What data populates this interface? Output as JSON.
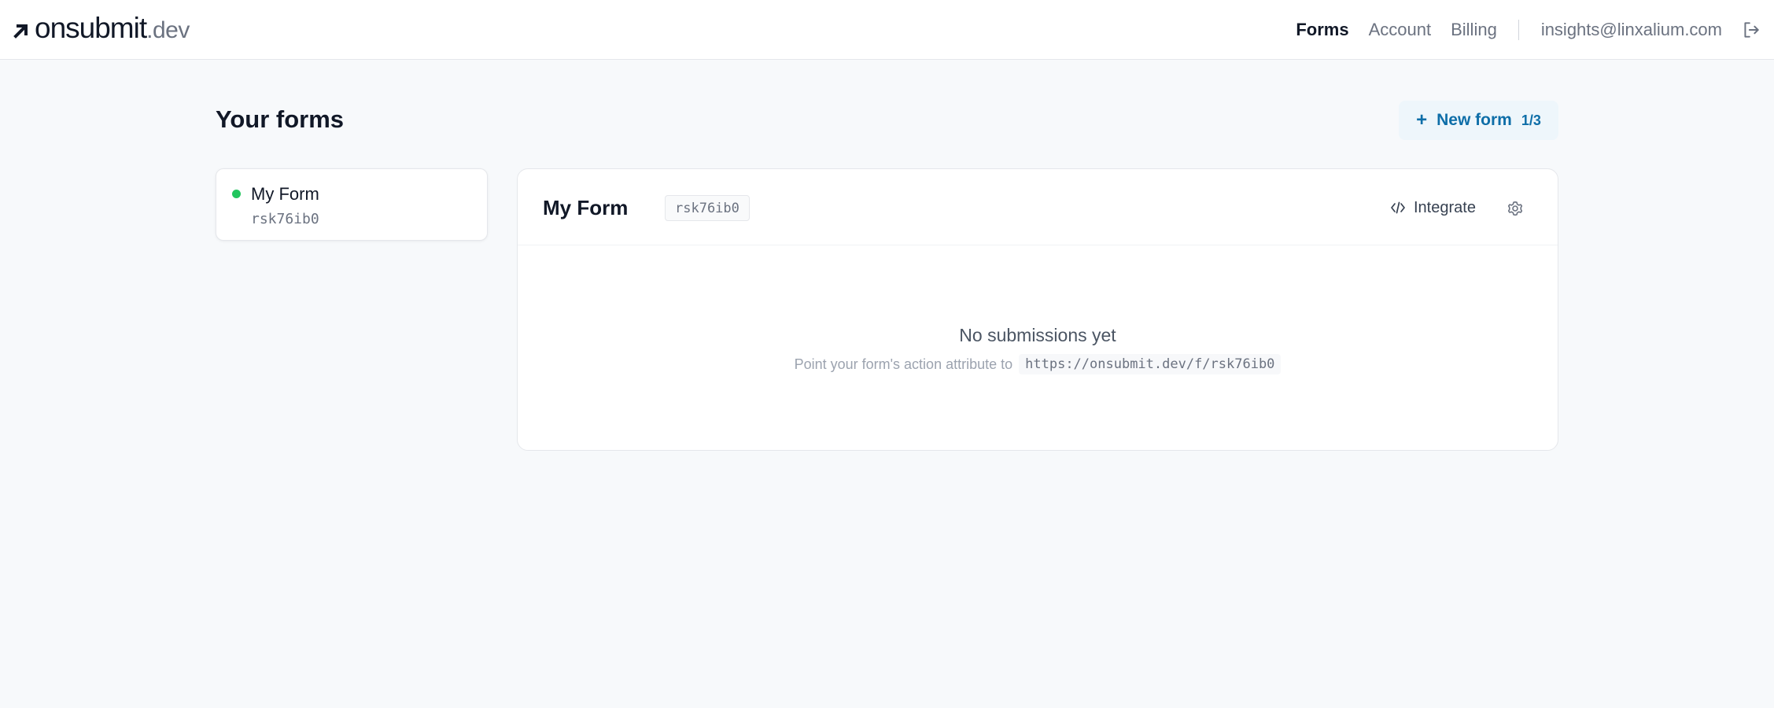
{
  "header": {
    "logo": {
      "main": "onsubmit",
      "tld": ".dev"
    },
    "nav": [
      {
        "label": "Forms",
        "active": true
      },
      {
        "label": "Account",
        "active": false
      },
      {
        "label": "Billing",
        "active": false
      }
    ],
    "user_email": "insights@linxalium.com",
    "logout_icon": "logout-icon"
  },
  "page": {
    "title": "Your forms",
    "new_form_button": {
      "plus": "+",
      "label": "New form",
      "quota": "1/3"
    }
  },
  "forms": [
    {
      "name": "My Form",
      "id": "rsk76ib0",
      "status": "active",
      "status_color": "#22c55e"
    }
  ],
  "detail": {
    "title": "My Form",
    "id": "rsk76ib0",
    "integrate_label": "Integrate",
    "integrate_icon": "code-icon",
    "settings_icon": "gear-icon",
    "empty": {
      "title": "No submissions yet",
      "hint": "Point your form's action attribute to",
      "url": "https://onsubmit.dev/f/rsk76ib0"
    }
  },
  "colors": {
    "accent": "#0e6ea8",
    "accent_bg": "#eef6fb",
    "background": "#f7f9fb"
  }
}
